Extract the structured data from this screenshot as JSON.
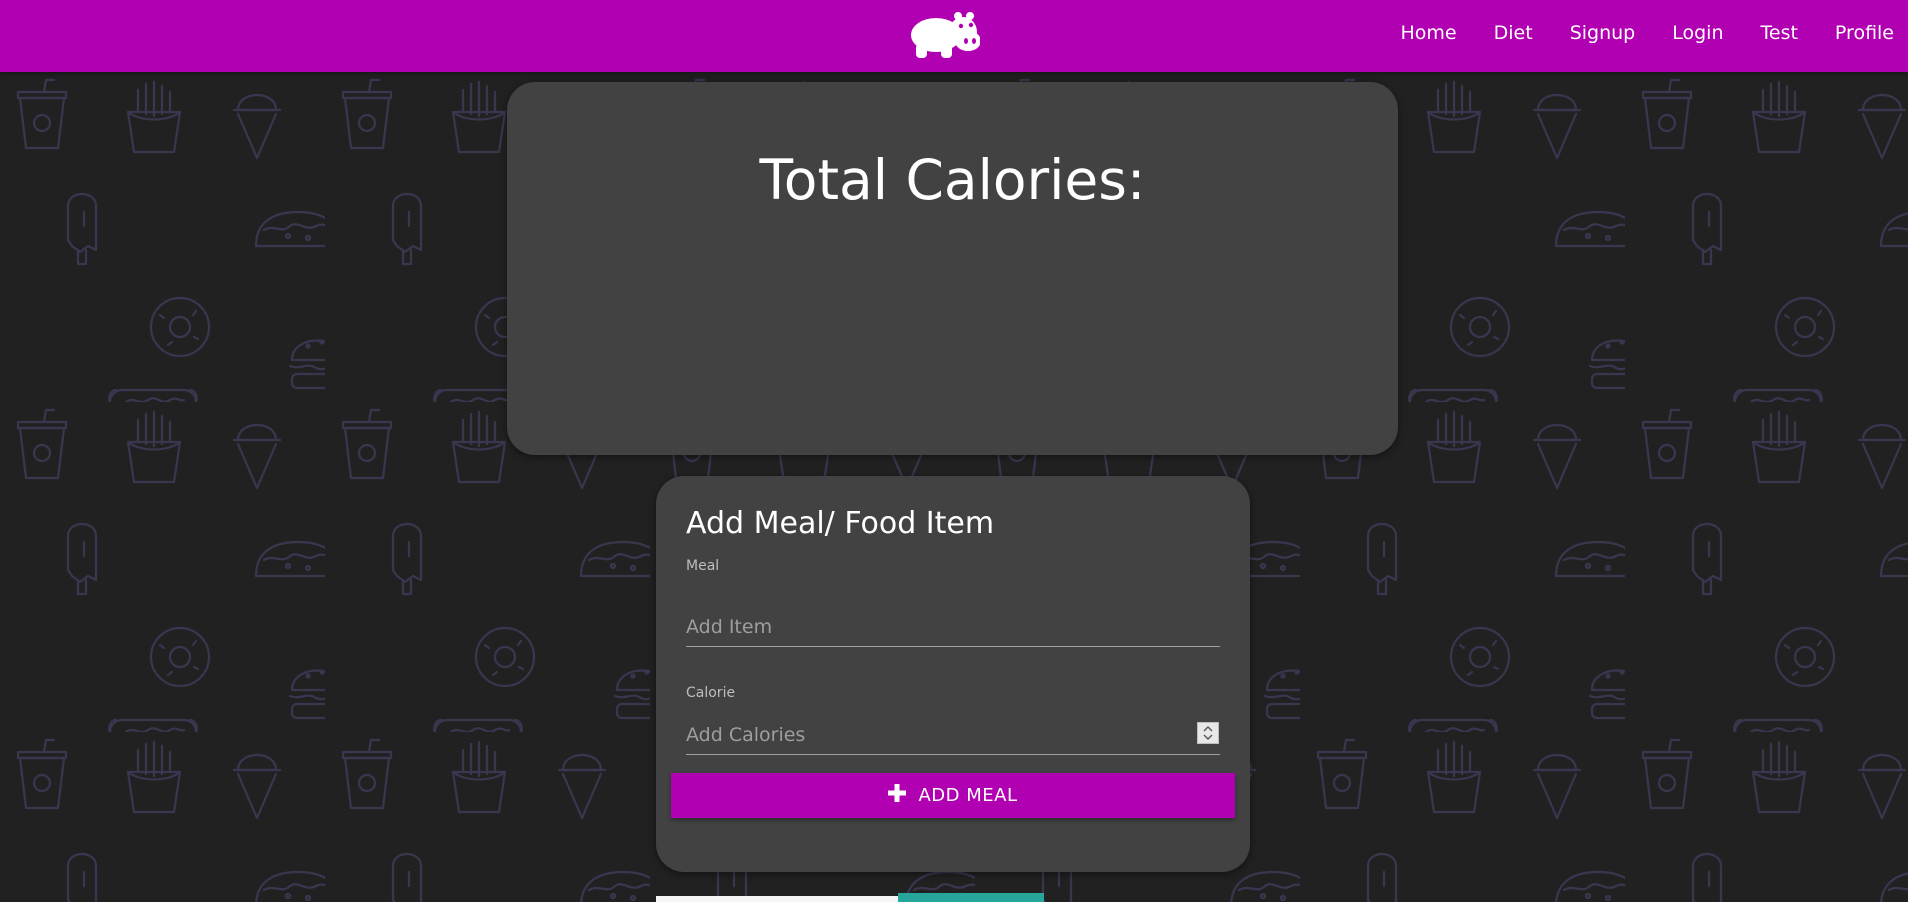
{
  "navbar": {
    "logo_icon": "hippo-icon",
    "color": "#b100b2",
    "links": [
      "Home",
      "Diet",
      "Signup",
      "Login",
      "Test",
      "Profile"
    ]
  },
  "total_card": {
    "title": "Total Calories:"
  },
  "meal_form": {
    "heading": "Add Meal/ Food Item",
    "meal_label": "Meal",
    "meal_placeholder": "Add Item",
    "calorie_label": "Calorie",
    "calorie_placeholder": "Add Calories",
    "button_label": "ADD MEAL",
    "button_icon": "plus-icon"
  },
  "background": {
    "color": "#212121",
    "pattern_color": "#3b3550",
    "pattern_icons": [
      "drink-cup-icon",
      "fries-icon",
      "ice-cream-icon",
      "popsicle-icon",
      "donut-icon",
      "taco-icon",
      "hot-dog-icon",
      "burger-icon"
    ]
  },
  "card_color": "#424242"
}
